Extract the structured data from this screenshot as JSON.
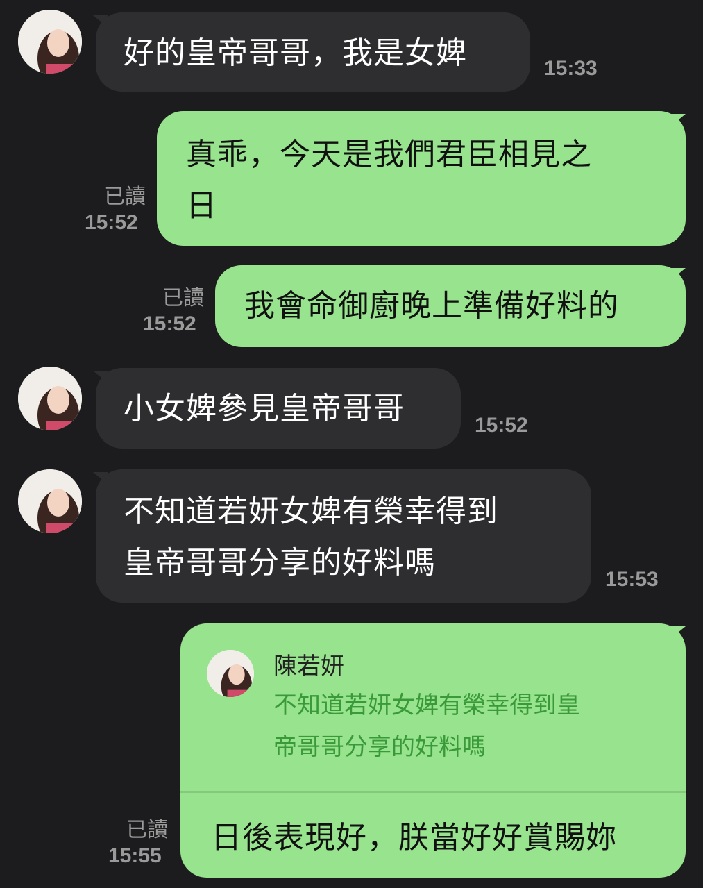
{
  "contact": {
    "name": "陳若妍"
  },
  "messages": [
    {
      "lines": [
        "好的皇帝哥哥，我是女婢"
      ],
      "time": "15:33"
    },
    {
      "lines": [
        "真乖，今天是我們君臣相見之",
        "日"
      ],
      "read": "已讀",
      "time": "15:52"
    },
    {
      "lines": [
        "我會命御廚晚上準備好料的"
      ],
      "read": "已讀",
      "time": "15:52"
    },
    {
      "lines": [
        "小女婢參見皇帝哥哥"
      ],
      "time": "15:52"
    },
    {
      "lines": [
        "不知道若妍女婢有榮幸得到",
        "皇帝哥哥分享的好料嗎"
      ],
      "time": "15:53"
    },
    {
      "reply_to": {
        "name": "陳若妍",
        "lines": [
          "不知道若妍女婢有榮幸得到皇",
          "帝哥哥分享的好料嗎"
        ]
      },
      "lines": [
        "日後表現好，朕當好好賞賜妳"
      ],
      "read": "已讀",
      "time": "15:55"
    }
  ],
  "colors": {
    "background": "#1c1c1e",
    "incoming": "#2e2e30",
    "outgoing": "#98e38e",
    "timestamp": "#9a9a9a"
  }
}
